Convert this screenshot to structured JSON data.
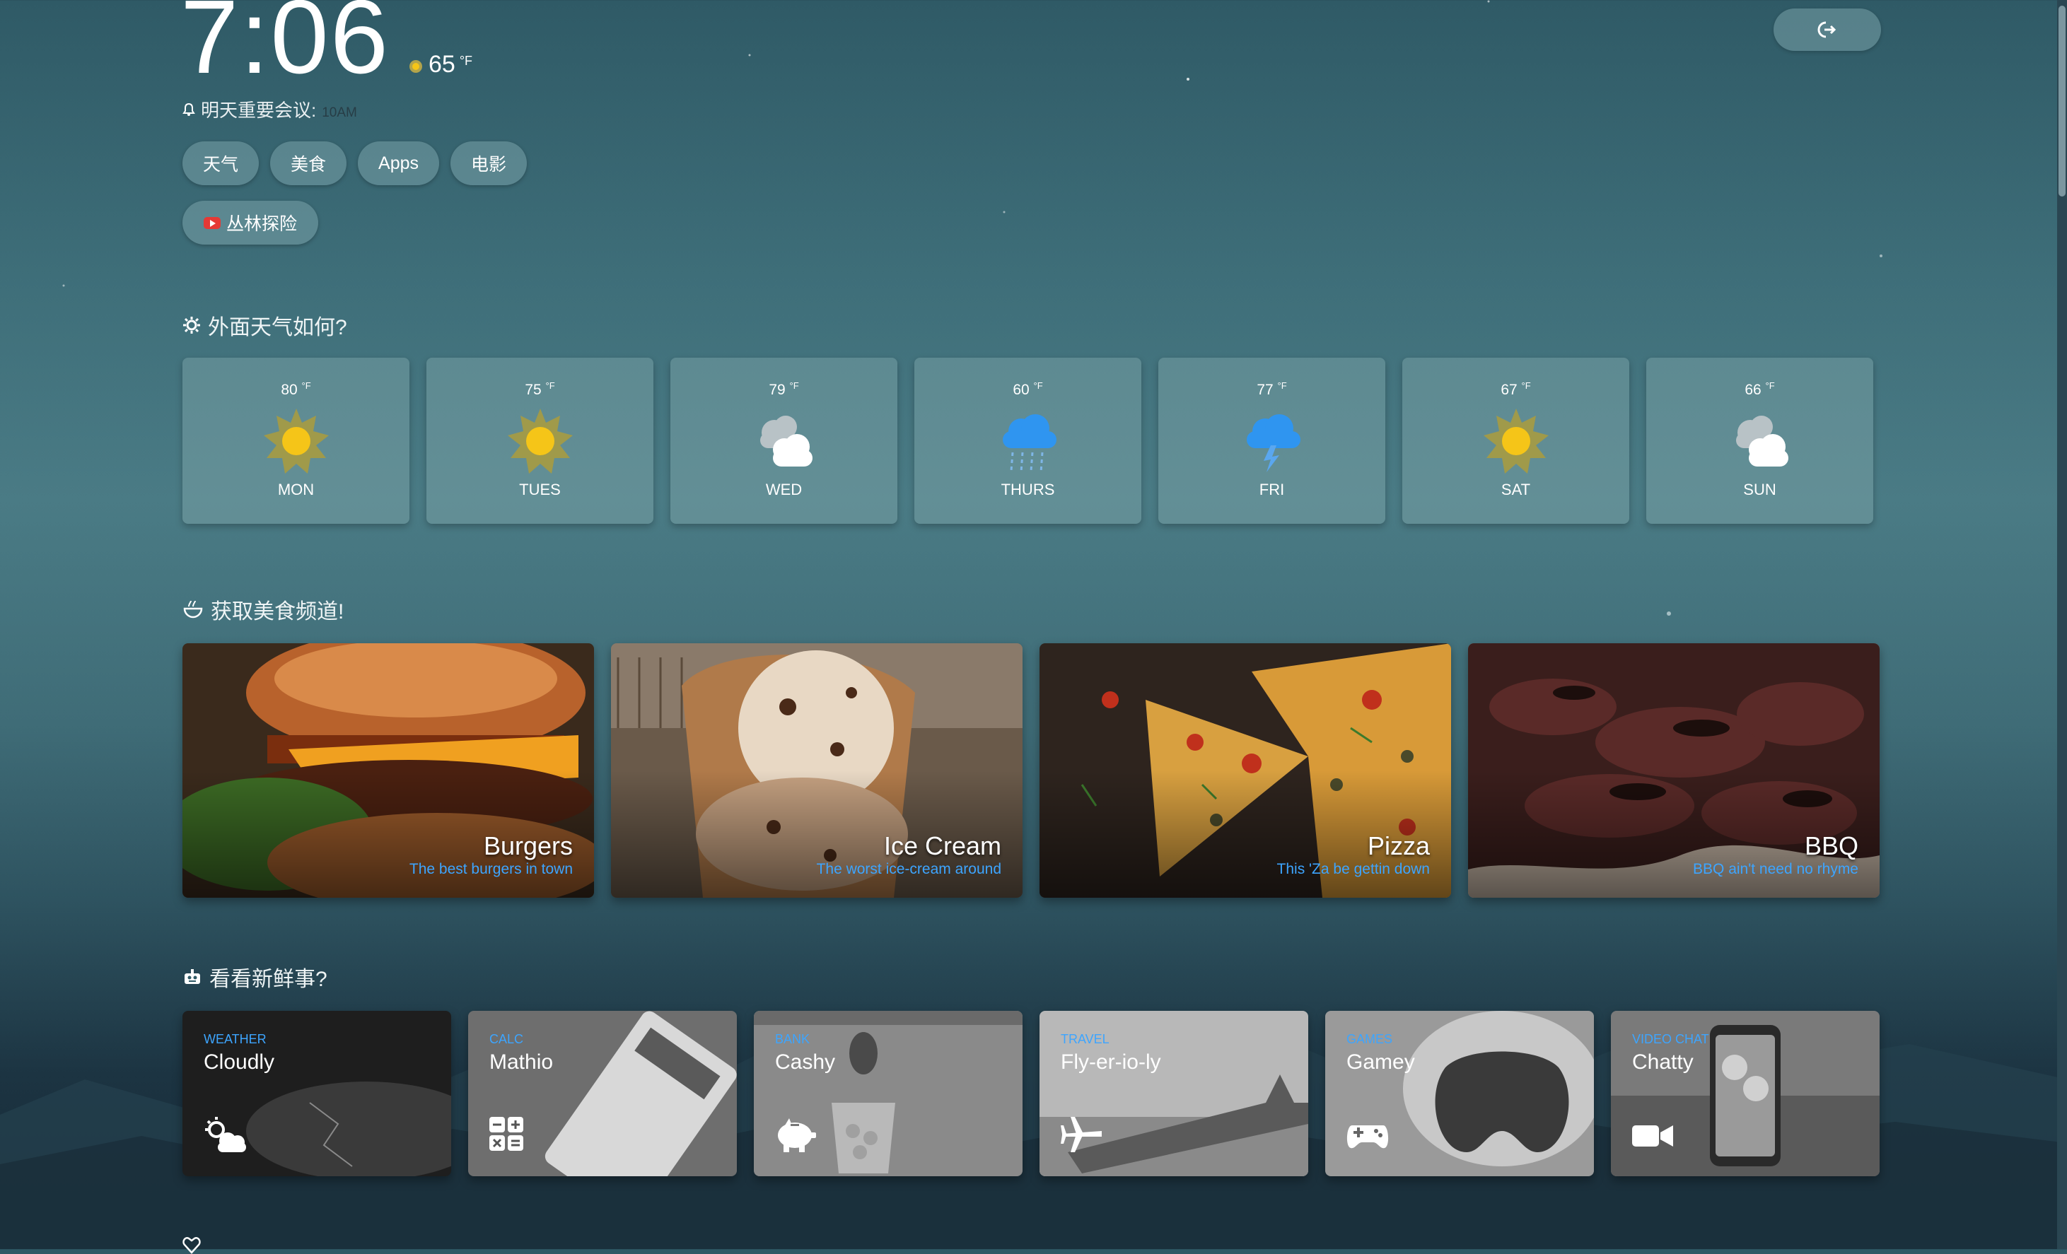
{
  "header": {
    "time": "7:06",
    "current_temp": "65",
    "temp_unit": "°F",
    "reminder_text": "明天重要会议:",
    "reminder_time": "10AM",
    "logout_icon": "logout-icon"
  },
  "pills": [
    "天气",
    "美食",
    "Apps",
    "电影"
  ],
  "video_pill": {
    "label": "丛林探险",
    "icon": "youtube-icon"
  },
  "weather_section": {
    "title": "外面天气如何?",
    "unit": "°F",
    "days": [
      {
        "temp": "80",
        "day": "MON",
        "icon": "sun-icon"
      },
      {
        "temp": "75",
        "day": "TUES",
        "icon": "sun-icon"
      },
      {
        "temp": "79",
        "day": "WED",
        "icon": "cloudy-icon"
      },
      {
        "temp": "60",
        "day": "THURS",
        "icon": "rain-icon"
      },
      {
        "temp": "77",
        "day": "FRI",
        "icon": "storm-icon"
      },
      {
        "temp": "67",
        "day": "SAT",
        "icon": "sun-icon"
      },
      {
        "temp": "66",
        "day": "SUN",
        "icon": "cloudy-icon"
      }
    ]
  },
  "food_section": {
    "title": "获取美食频道!",
    "cards": [
      {
        "name": "Burgers",
        "desc": "The best burgers in town"
      },
      {
        "name": "Ice Cream",
        "desc": "The worst ice-cream around"
      },
      {
        "name": "Pizza",
        "desc": "This 'Za be gettin down"
      },
      {
        "name": "BBQ",
        "desc": "BBQ ain't need no rhyme"
      }
    ]
  },
  "apps_section": {
    "title": "看看新鲜事?",
    "cards": [
      {
        "category": "WEATHER",
        "name": "Cloudly",
        "icon": "cloud-sun-icon"
      },
      {
        "category": "CALC",
        "name": "Mathio",
        "icon": "calculator-icon"
      },
      {
        "category": "BANK",
        "name": "Cashy",
        "icon": "piggy-bank-icon"
      },
      {
        "category": "TRAVEL",
        "name": "Fly-er-io-ly",
        "icon": "airplane-icon"
      },
      {
        "category": "GAMES",
        "name": "Gamey",
        "icon": "gamepad-icon"
      },
      {
        "category": "VIDEO CHAT",
        "name": "Chatty",
        "icon": "video-camera-icon"
      }
    ]
  },
  "colors": {
    "accent": "#3da5ff",
    "sun": "#f5c518"
  }
}
